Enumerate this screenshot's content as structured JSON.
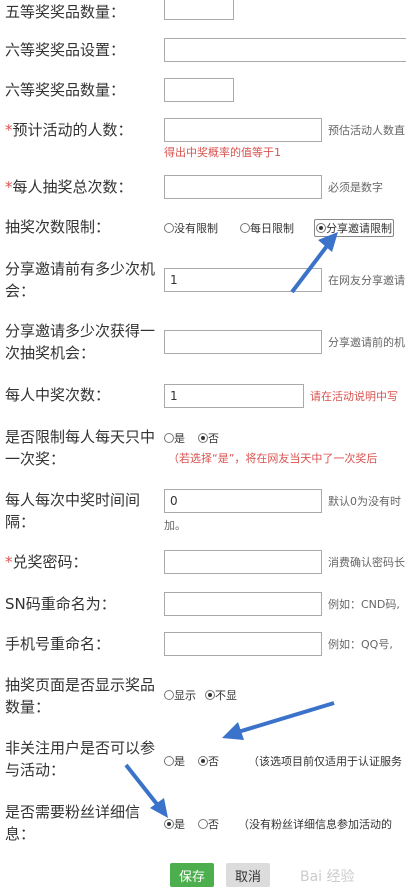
{
  "fields": {
    "fifth_qty": {
      "label": "五等奖奖品数量："
    },
    "sixth_setting": {
      "label": "六等奖奖品设置："
    },
    "sixth_qty": {
      "label": "六等奖奖品数量："
    },
    "est_people": {
      "label": "预计活动的人数：",
      "hint": "预估活动人数直",
      "note": "得出中奖概率的值等于1"
    },
    "total_draws": {
      "label": "每人抽奖总次数：",
      "hint": "必须是数字"
    },
    "draw_limit": {
      "label": "抽奖次数限制：",
      "options": [
        "没有限制",
        "每日限制",
        "分享邀请限制"
      ]
    },
    "share_before": {
      "label_line1": "分享邀请前有多少次机",
      "label_line2": "会：",
      "value": "1",
      "hint": "在网友分享邀请"
    },
    "share_gain": {
      "label_line1": "分享邀请多少次获得一",
      "label_line2": "次抽奖机会：",
      "hint": "分享邀请前的机"
    },
    "win_times": {
      "label": "每人中奖次数：",
      "value": "1",
      "hint": "请在活动说明中写"
    },
    "daily_once": {
      "label_line1": "是否限制每人每天只中",
      "label_line2": "一次奖：",
      "opt_yes": "是",
      "opt_no": "否",
      "note": "（若选择“是”，将在网友当天中了一次奖后"
    },
    "interval": {
      "label_line1": "每人每次中奖时间间",
      "label_line2": "隔：",
      "value": "0",
      "hint": "默认0为没有时",
      "hint2": "加。"
    },
    "redeem_pwd": {
      "label": "兑奖密码：",
      "hint": "消费确认密码长"
    },
    "sn_rename": {
      "label": "SN码重命名为：",
      "hint": "例如：CND码,"
    },
    "phone_rename": {
      "label": "手机号重命名：",
      "hint": "例如：QQ号,"
    },
    "show_prize_qty": {
      "label_line1": "抽奖页面是否显示奖品",
      "label_line2": "数量：",
      "opt_show": "显示",
      "opt_hide": "不显"
    },
    "non_follow": {
      "label_line1": "非关注用户是否可以参",
      "label_line2": "与活动：",
      "opt_yes": "是",
      "opt_no": "否",
      "note": "（该选项目前仅适用于认证服务"
    },
    "fan_detail": {
      "label_line1": "是否需要粉丝详细信",
      "label_line2": "息：",
      "opt_yes": "是",
      "opt_no": "否",
      "note": "（没有粉丝详细信息参加活动的"
    }
  },
  "required_mark": "*",
  "buttons": {
    "save": "保存",
    "cancel": "取消"
  },
  "watermark": "Bai 经验"
}
